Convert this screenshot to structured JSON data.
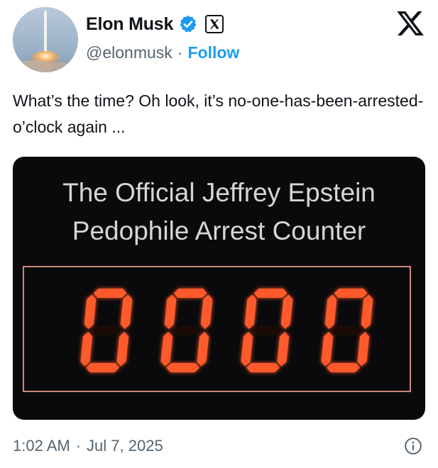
{
  "tweet": {
    "author": {
      "display_name": "Elon Musk",
      "handle": "@elonmusk",
      "separator": "·",
      "follow_label": "Follow",
      "verified_icon": "verified-badge-icon",
      "affiliation_icon": "x-affiliation-icon"
    },
    "platform_icon": "x-logo-icon",
    "text": "What’s the time? Oh look, it’s no-one-has-been-arrested-o’clock again ...",
    "media": {
      "title_line1": "The Official Jeffrey Epstein",
      "title_line2": "Pedophile Arrest Counter",
      "counter_value": "0000"
    },
    "footer": {
      "time": "1:02 AM",
      "separator": "·",
      "date": "Jul 7, 2025",
      "info_icon": "info-icon"
    }
  },
  "colors": {
    "accent": "#1d9bf0",
    "secondary_text": "#536471",
    "primary_text": "#0f1419",
    "counter_digit": "#ff5a2c",
    "counter_border": "#c98a7c",
    "media_background": "#0a0a0c"
  }
}
